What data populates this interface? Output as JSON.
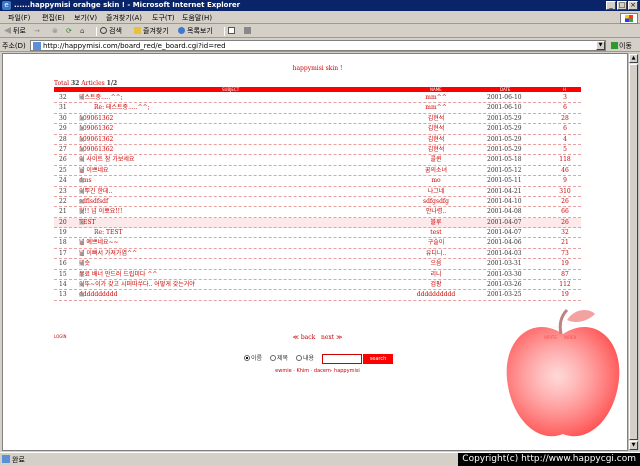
{
  "window": {
    "title": "......happymisi orahge skin ! - Microsoft Internet Explorer",
    "minimize": "_",
    "maximize": "□",
    "close": "×"
  },
  "menu": [
    "파일(F)",
    "편집(E)",
    "보기(V)",
    "즐겨찾기(A)",
    "도구(T)",
    "도움말(H)"
  ],
  "toolbar": {
    "back": "뒤로",
    "forward": "→",
    "stop": "⊗",
    "refresh": "⟳",
    "home": "⌂",
    "search": "검색",
    "favorites": "즐겨찾기",
    "history": "목록보기"
  },
  "address": {
    "label": "주소(D)",
    "url": "http://happymisi.com/board_red/e_board.cgi?id=red",
    "go": "이동"
  },
  "board": {
    "title": "happymisi skin !",
    "total_prefix": "Total",
    "total_count": "32",
    "articles_label": "Articles",
    "page": "1/2",
    "headers": {
      "subject": "SUBJECT",
      "name": "NAME",
      "date": "DATE",
      "hits": "H"
    },
    "rows": [
      {
        "num": "32",
        "subject": "테스트중.....^^;",
        "reply": false,
        "name": "mm^^",
        "date": "2001-06-10",
        "hits": "3"
      },
      {
        "num": "31",
        "subject": "Re: 테스트중.....^^;",
        "reply": true,
        "name": "mm^^",
        "date": "2001-06-10",
        "hits": "6"
      },
      {
        "num": "30",
        "subject": "109061362",
        "reply": false,
        "name": "김현석",
        "date": "2001-05-29",
        "hits": "28"
      },
      {
        "num": "29",
        "subject": "109061362",
        "reply": false,
        "name": "김현석",
        "date": "2001-05-29",
        "hits": "6"
      },
      {
        "num": "28",
        "subject": "109061362",
        "reply": false,
        "name": "김현석",
        "date": "2001-05-29",
        "hits": "4"
      },
      {
        "num": "27",
        "subject": "109061362",
        "reply": false,
        "name": "김현석",
        "date": "2001-05-29",
        "hits": "5"
      },
      {
        "num": "26",
        "subject": "이 사이트 참 가보세요",
        "reply": false,
        "name": "콜퀸",
        "date": "2001-05-18",
        "hits": "118"
      },
      {
        "num": "25",
        "subject": "넘 이쁘네요",
        "reply": false,
        "name": "꿈의소녀",
        "date": "2001-05-12",
        "hits": "46"
      },
      {
        "num": "24",
        "subject": "dms",
        "reply": false,
        "name": "mo",
        "date": "2001-05-11",
        "hits": "9"
      },
      {
        "num": "23",
        "subject": "이뿌긴 한데..",
        "reply": false,
        "name": "나그네",
        "date": "2001-04-21",
        "hits": "310"
      },
      {
        "num": "22",
        "subject": "sdflsdfsdf",
        "reply": false,
        "name": "sdfgsdfg",
        "date": "2001-04-10",
        "hits": "26"
      },
      {
        "num": "21",
        "subject": "핫!! 넘 이뽀요!!!",
        "reply": false,
        "name": "안나령..",
        "date": "2001-04-08",
        "hits": "66"
      },
      {
        "num": "20",
        "subject": "TEST",
        "reply": false,
        "name": "블루",
        "date": "2001-04-07",
        "hits": "26",
        "highlight": true
      },
      {
        "num": "19",
        "subject": "Re: TEST",
        "reply": true,
        "name": "test",
        "date": "2001-04-07",
        "hits": "32"
      },
      {
        "num": "18",
        "subject": "넘 예쁘네요~~",
        "reply": false,
        "name": "구슬이",
        "date": "2001-04-06",
        "hits": "21"
      },
      {
        "num": "17",
        "subject": "넘 이뻐서 가져가염^^",
        "reply": false,
        "name": "유디니..",
        "date": "2001-04-03",
        "hits": "73"
      },
      {
        "num": "16",
        "subject": "테슷",
        "reply": false,
        "name": "으음",
        "date": "2001-03-31",
        "hits": "19"
      },
      {
        "num": "15",
        "subject": "무료 배너 만드러 드립미다 ^^",
        "reply": false,
        "name": "리니",
        "date": "2001-03-30",
        "hits": "87"
      },
      {
        "num": "14",
        "subject": "이뚜~이가 갖고 시퍼따쑤다.. 어떻게 갖는거야",
        "reply": false,
        "name": "검팡",
        "date": "2001-03-26",
        "hits": "112"
      },
      {
        "num": "13",
        "subject": "dddddddddd",
        "reply": false,
        "name": "dddddddddd",
        "date": "2001-03-25",
        "hits": "19"
      }
    ],
    "login": "LOGIN",
    "back": "back",
    "next": "next",
    "write": "WRITE",
    "index": "INDEX",
    "search": {
      "opt1": "이름",
      "opt2": "제목",
      "opt3": "내용",
      "button": "search"
    },
    "credit": "ewmie · Khim · dacem· happymisi"
  },
  "status": {
    "text": "완료"
  },
  "copyright": "Copyright(c) http://www.happycgi.com"
}
